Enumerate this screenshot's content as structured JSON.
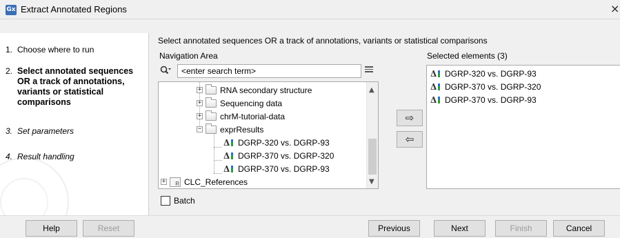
{
  "window": {
    "app_icon": "Gx",
    "title": "Extract Annotated Regions",
    "close_glyph": "×"
  },
  "steps": [
    {
      "num": "1.",
      "label": "Choose where to run"
    },
    {
      "num": "2.",
      "label": "Select annotated sequences OR a track of annotations, variants or statistical comparisons"
    },
    {
      "num": "3.",
      "label": "Set parameters"
    },
    {
      "num": "4.",
      "label": "Result handling"
    }
  ],
  "main": {
    "hint": "Select annotated sequences OR a track of annotations, variants or statistical comparisons",
    "navigation_label": "Navigation Area",
    "selected_label": "Selected elements (3)",
    "search_value": "<enter search term>"
  },
  "tree": [
    {
      "label": "RNA secondary structure",
      "icon": "folder-icon",
      "expander": "+"
    },
    {
      "label": "Sequencing data",
      "icon": "folder-icon",
      "expander": "+"
    },
    {
      "label": "chrM-tutorial-data",
      "icon": "folder-icon",
      "expander": "+"
    },
    {
      "label": "exprResults",
      "icon": "folder-open-icon",
      "expander": "−"
    },
    {
      "label": "DGRP-320 vs. DGRP-93",
      "icon": "statistical-comparison-icon"
    },
    {
      "label": "DGRP-370 vs. DGRP-320",
      "icon": "statistical-comparison-icon"
    },
    {
      "label": "DGRP-370 vs. DGRP-93",
      "icon": "statistical-comparison-icon"
    },
    {
      "label": "CLC_References",
      "icon": "reference-folder-icon",
      "expander": "+"
    }
  ],
  "selected": [
    {
      "label": "DGRP-320 vs. DGRP-93",
      "icon": "statistical-comparison-icon"
    },
    {
      "label": "DGRP-370 vs. DGRP-320",
      "icon": "statistical-comparison-icon"
    },
    {
      "label": "DGRP-370 vs. DGRP-93",
      "icon": "statistical-comparison-icon"
    }
  ],
  "batch_label": "Batch",
  "buttons": {
    "help": "Help",
    "reset": "Reset",
    "previous": "Previous",
    "next": "Next",
    "finish": "Finish",
    "cancel": "Cancel"
  },
  "icons": {
    "stats_glyph": "Δ",
    "add_arrow": "⇨",
    "remove_arrow": "⇦",
    "scroll_up": "▲",
    "scroll_down": "▼"
  }
}
